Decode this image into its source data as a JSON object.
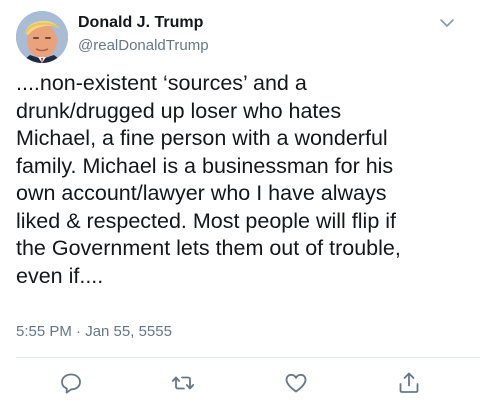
{
  "author": {
    "display_name": "Donald J. Trump",
    "handle": "@realDonaldTrump",
    "avatar_icon": "profile-photo"
  },
  "tweet": {
    "text": "....non-existent ‘sources’ and a\ndrunk/drugged up loser who hates\nMichael, a fine person with a wonderful\nfamily. Michael is a businessman for his\nown account/lawyer who I have always\nliked & respected. Most people will flip if\nthe Government lets them out of trouble,\neven if....",
    "timestamp": "5:55 PM · Jan 55, 5555"
  },
  "actions": [
    {
      "name": "reply",
      "icon": "reply-icon"
    },
    {
      "name": "retweet",
      "icon": "retweet-icon"
    },
    {
      "name": "like",
      "icon": "heart-icon"
    },
    {
      "name": "share",
      "icon": "share-icon"
    }
  ],
  "menu": {
    "icon": "chevron-down-icon"
  },
  "colors": {
    "text": "#14171a",
    "secondary": "#657786",
    "divider": "#e1e8ed"
  }
}
